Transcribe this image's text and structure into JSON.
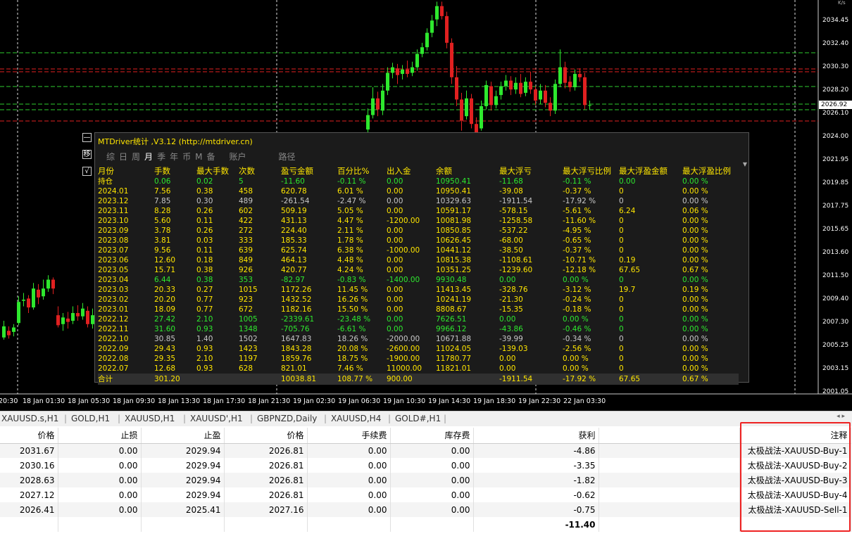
{
  "chart": {
    "top_right_text": "K/s",
    "current_price": "2026.92",
    "price_labels": [
      "2034.45",
      "2032.40",
      "2030.30",
      "2028.20",
      "2026.10",
      "2024.00",
      "2021.95",
      "2019.85",
      "2017.75",
      "2015.65",
      "2013.60",
      "2011.50",
      "2009.40",
      "2007.30",
      "2005.25",
      "2003.15",
      "2001.05"
    ],
    "time_labels": [
      "20:30",
      "18 Jan 01:30",
      "18 Jan 05:30",
      "18 Jan 09:30",
      "18 Jan 13:30",
      "18 Jan 17:30",
      "18 Jan 21:30",
      "19 Jan 02:30",
      "19 Jan 06:30",
      "19 Jan 10:30",
      "19 Jan 14:30",
      "19 Jan 18:30",
      "19 Jan 22:30",
      "22 Jan 03:30"
    ],
    "colors": {
      "bull": "#2ee82e",
      "bear": "#e02020",
      "green_line": "#2ecc2e",
      "red_line": "#e02020"
    }
  },
  "stats": {
    "title": "MTDriver统计 ,V3.12 (http://mtdriver.cn)",
    "side_buttons": [
      "—",
      "移",
      "√"
    ],
    "tabs": [
      "综",
      "日",
      "周",
      "月",
      "季",
      "年",
      "币",
      "M",
      "备",
      "账户",
      "路径"
    ],
    "active_tab": "月",
    "columns": [
      "月份",
      "手数",
      "最大手数",
      "次数",
      "盈亏金额",
      "百分比%",
      "出入金",
      "余额",
      "最大浮亏",
      "最大浮亏比例",
      "最大浮盈金额",
      "最大浮盈比例"
    ],
    "rows": [
      [
        "持仓",
        "0.06",
        "0.02",
        "5",
        "-11.60",
        "-0.11 %",
        "0.00",
        "10950.41",
        "-11.68",
        "-0.11 %",
        "0.00",
        "0.00 %"
      ],
      [
        "2024.01",
        "7.56",
        "0.38",
        "458",
        "620.78",
        "6.01 %",
        "0.00",
        "10950.41",
        "-39.08",
        "-0.37 %",
        "0",
        "0.00 %"
      ],
      [
        "2023.12",
        "7.85",
        "0.30",
        "489",
        "-261.54",
        "-2.47 %",
        "0.00",
        "10329.63",
        "-1911.54",
        "-17.92 %",
        "0",
        "0.00 %"
      ],
      [
        "2023.11",
        "8.28",
        "0.26",
        "602",
        "509.19",
        "5.05 %",
        "0.00",
        "10591.17",
        "-578.15",
        "-5.61 %",
        "6.24",
        "0.06 %"
      ],
      [
        "2023.10",
        "5.60",
        "0.11",
        "422",
        "431.13",
        "4.47 %",
        "-1200.00",
        "10081.98",
        "-1258.58",
        "-11.60 %",
        "0",
        "0.00 %"
      ],
      [
        "2023.09",
        "3.78",
        "0.26",
        "272",
        "224.40",
        "2.11 %",
        "0.00",
        "10850.85",
        "-537.22",
        "-4.95 %",
        "0",
        "0.00 %"
      ],
      [
        "2023.08",
        "3.81",
        "0.03",
        "333",
        "185.33",
        "1.78 %",
        "0.00",
        "10626.45",
        "-68.00",
        "-0.65 %",
        "0",
        "0.00 %"
      ],
      [
        "2023.07",
        "9.56",
        "0.11",
        "639",
        "625.74",
        "6.38 %",
        "-1000.00",
        "10441.12",
        "-38.50",
        "-0.37 %",
        "0",
        "0.00 %"
      ],
      [
        "2023.06",
        "12.60",
        "0.18",
        "849",
        "464.13",
        "4.48 %",
        "0.00",
        "10815.38",
        "-1108.61",
        "-10.71 %",
        "0.19",
        "0.00 %"
      ],
      [
        "2023.05",
        "15.71",
        "0.38",
        "926",
        "420.77",
        "4.24 %",
        "0.00",
        "10351.25",
        "-1239.60",
        "-12.18 %",
        "67.65",
        "0.67 %"
      ],
      [
        "2023.04",
        "6.44",
        "0.38",
        "353",
        "-82.97",
        "-0.83 %",
        "-1400.00",
        "9930.48",
        "0.00",
        "0.00 %",
        "0",
        "0.00 %"
      ],
      [
        "2023.03",
        "20.33",
        "0.27",
        "1015",
        "1172.26",
        "11.45 %",
        "0.00",
        "11413.45",
        "-328.76",
        "-3.12 %",
        "19.7",
        "0.19 %"
      ],
      [
        "2023.02",
        "20.20",
        "0.77",
        "923",
        "1432.52",
        "16.26 %",
        "0.00",
        "10241.19",
        "-21.30",
        "-0.24 %",
        "0",
        "0.00 %"
      ],
      [
        "2023.01",
        "18.09",
        "0.77",
        "672",
        "1182.16",
        "15.50 %",
        "0.00",
        "8808.67",
        "-15.35",
        "-0.18 %",
        "0",
        "0.00 %"
      ],
      [
        "2022.12",
        "27.42",
        "2.10",
        "1005",
        "-2339.61",
        "-23.48 %",
        "0.00",
        "7626.51",
        "0.00",
        "0.00 %",
        "0",
        "0.00 %"
      ],
      [
        "2022.11",
        "31.60",
        "0.93",
        "1348",
        "-705.76",
        "-6.61 %",
        "0.00",
        "9966.12",
        "-43.86",
        "-0.46 %",
        "0",
        "0.00 %"
      ],
      [
        "2022.10",
        "30.85",
        "1.40",
        "1502",
        "1647.83",
        "18.26 %",
        "-2000.00",
        "10671.88",
        "-39.99",
        "-0.34 %",
        "0",
        "0.00 %"
      ],
      [
        "2022.09",
        "29.43",
        "0.93",
        "1423",
        "1843.28",
        "20.08 %",
        "-2600.00",
        "11024.05",
        "-139.03",
        "-2.56 %",
        "0",
        "0.00 %"
      ],
      [
        "2022.08",
        "29.35",
        "2.10",
        "1197",
        "1859.76",
        "18.75 %",
        "-1900.00",
        "11780.77",
        "0.00",
        "0.00 %",
        "0",
        "0.00 %"
      ],
      [
        "2022.07",
        "12.68",
        "0.93",
        "628",
        "821.01",
        "7.46 %",
        "11000.00",
        "11821.01",
        "0.00",
        "0.00 %",
        "0",
        "0.00 %"
      ]
    ],
    "row_colors": [
      "g",
      "y",
      "w",
      "y",
      "y",
      "y",
      "y",
      "y",
      "y",
      "y",
      "g",
      "y",
      "y",
      "y",
      "g",
      "g",
      "w",
      "y",
      "y",
      "y"
    ],
    "total": [
      "合计",
      "301.20",
      "",
      "",
      "10038.81",
      "108.77 %",
      "900.00",
      "",
      "-1911.54",
      "-17.92 %",
      "67.65",
      "0.67 %"
    ]
  },
  "tabbar": {
    "tabs": [
      "XAUUSD.s,H1",
      "GOLD,H1",
      "XAUUSD,H1",
      "XAUUSD',H1",
      "GBPNZD,Daily",
      "XAUUSD,H4",
      "GOLD#,H1"
    ],
    "arrows": "◂  ▸"
  },
  "orders": {
    "columns": [
      "价格",
      "止损",
      "止盈",
      "价格",
      "手续费",
      "库存费",
      "获利",
      "",
      "注释"
    ],
    "rows": [
      [
        "2031.67",
        "0.00",
        "2029.94",
        "2026.81",
        "0.00",
        "0.00",
        "-4.86",
        "",
        "太极战法-XAUUSD-Buy-1"
      ],
      [
        "2030.16",
        "0.00",
        "2029.94",
        "2026.81",
        "0.00",
        "0.00",
        "-3.35",
        "",
        "太极战法-XAUUSD-Buy-2"
      ],
      [
        "2028.63",
        "0.00",
        "2029.94",
        "2026.81",
        "0.00",
        "0.00",
        "-1.82",
        "",
        "太极战法-XAUUSD-Buy-3"
      ],
      [
        "2027.12",
        "0.00",
        "2029.94",
        "2026.81",
        "0.00",
        "0.00",
        "-0.62",
        "",
        "太极战法-XAUUSD-Buy-4"
      ],
      [
        "2026.41",
        "0.00",
        "2025.41",
        "2027.16",
        "0.00",
        "0.00",
        "-0.75",
        "",
        "太极战法-XAUUSD-Sell-1"
      ]
    ],
    "total_profit": "-11.40"
  }
}
